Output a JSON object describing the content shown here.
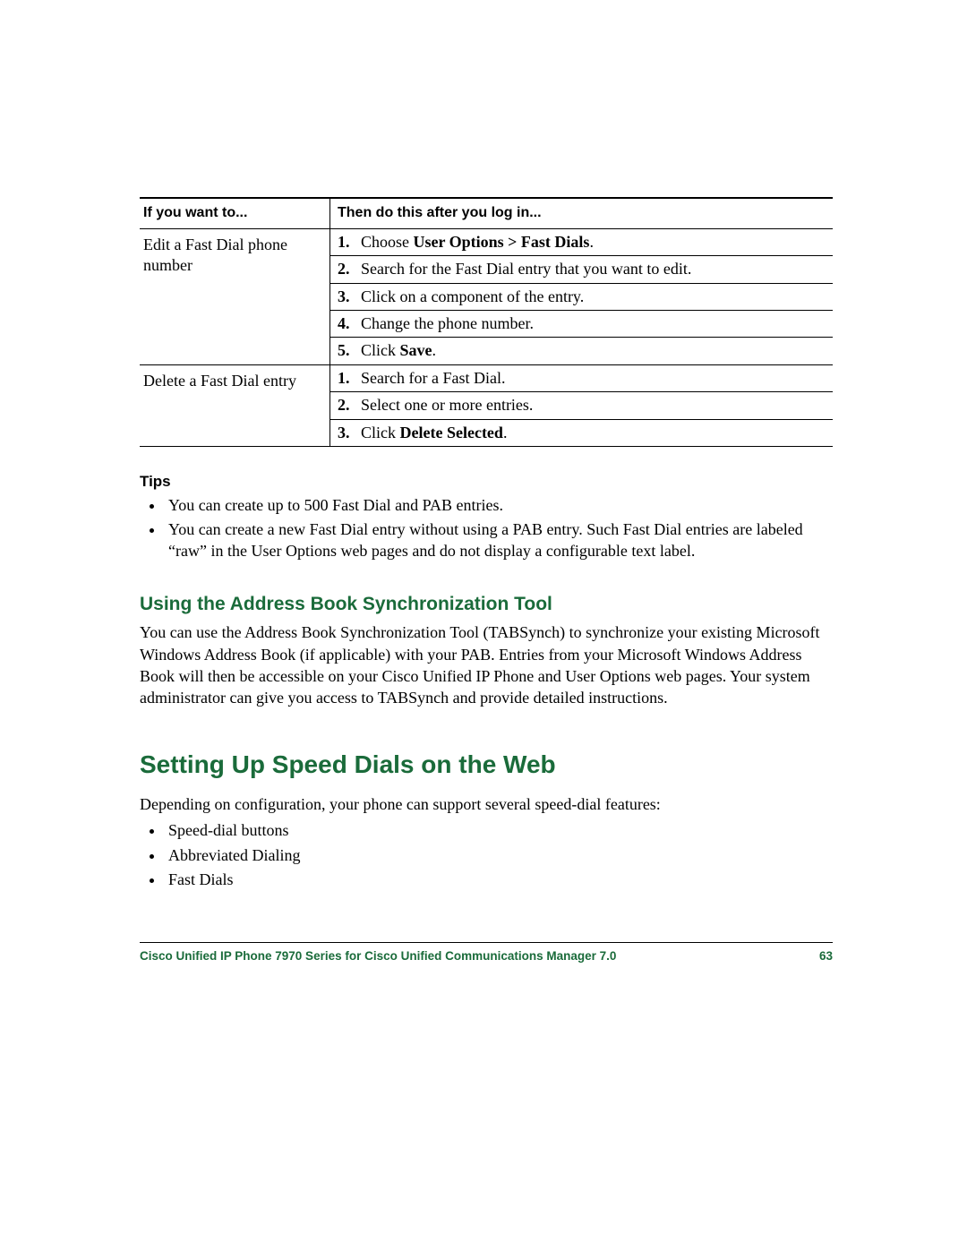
{
  "table": {
    "head1": "If you want to...",
    "head2": "Then do this after you log in...",
    "rows": [
      {
        "task": "Edit a Fast Dial phone number",
        "steps": [
          {
            "n": "1.",
            "pre": "Choose ",
            "bold": "User Options > Fast Dials",
            "post": "."
          },
          {
            "n": "2.",
            "pre": "Search for the Fast Dial entry that you want to edit.",
            "bold": "",
            "post": ""
          },
          {
            "n": "3.",
            "pre": "Click on a component of the entry.",
            "bold": "",
            "post": ""
          },
          {
            "n": "4.",
            "pre": "Change the phone number.",
            "bold": "",
            "post": ""
          },
          {
            "n": "5.",
            "pre": "Click ",
            "bold": "Save",
            "post": "."
          }
        ]
      },
      {
        "task": "Delete a Fast Dial entry",
        "steps": [
          {
            "n": "1.",
            "pre": "Search for a Fast Dial.",
            "bold": "",
            "post": ""
          },
          {
            "n": "2.",
            "pre": "Select one or more entries.",
            "bold": "",
            "post": ""
          },
          {
            "n": "3.",
            "pre": "Click ",
            "bold": "Delete Selected",
            "post": "."
          }
        ]
      }
    ]
  },
  "tips_heading": "Tips",
  "tips": [
    "You can create up to 500 Fast Dial and PAB entries.",
    "You can create a new Fast Dial entry without using a PAB entry. Such Fast Dial entries are labeled “raw” in the User Options web pages and do not display a configurable text label."
  ],
  "sub_heading": "Using the Address Book Synchronization Tool",
  "sub_body": "You can use the Address Book Synchronization Tool (TABSynch) to synchronize your existing Microsoft Windows Address Book (if applicable) with your PAB. Entries from your Microsoft Windows Address Book will then be accessible on your Cisco Unified IP Phone and User Options web pages. Your system administrator can give you access to TABSynch and provide detailed instructions.",
  "main_heading": "Setting Up Speed Dials on the Web",
  "main_body": "Depending on configuration, your phone can support several speed-dial features:",
  "features": [
    "Speed-dial buttons",
    "Abbreviated Dialing",
    "Fast Dials"
  ],
  "footer_title": "Cisco Unified IP Phone 7970 Series for Cisco Unified Communications Manager 7.0",
  "footer_page": "63"
}
